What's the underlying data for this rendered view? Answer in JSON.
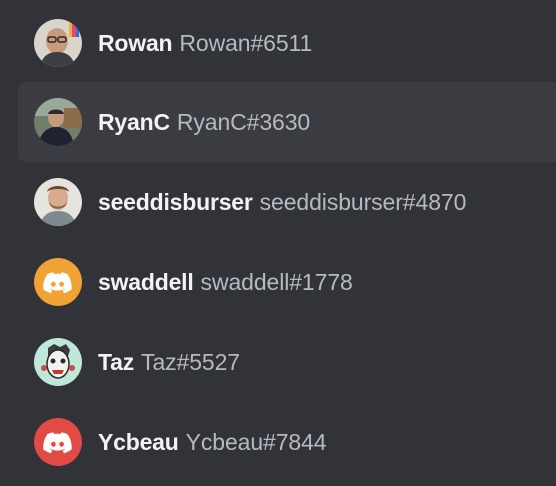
{
  "colors": {
    "background": "#313338",
    "hover_row": "#3a3c42",
    "name_text": "#f2f3f5",
    "tag_text": "#b5bac1",
    "swaddell_avatar_bg": "#f0a232",
    "ycbeau_avatar_bg": "#e24a46"
  },
  "members": [
    {
      "name": "Rowan",
      "tag": "Rowan#6511",
      "avatar": "photo-man-glasses-icon"
    },
    {
      "name": "RyanC",
      "tag": "RyanC#3630",
      "avatar": "photo-man-outdoors-icon"
    },
    {
      "name": "seeddisburser",
      "tag": "seeddisburser#4870",
      "avatar": "photo-man-beard-icon"
    },
    {
      "name": "swaddell",
      "tag": "swaddell#1778",
      "avatar": "discord-logo-icon"
    },
    {
      "name": "Taz",
      "tag": "Taz#5527",
      "avatar": "illustrated-face-icon"
    },
    {
      "name": "Ycbeau",
      "tag": "Ycbeau#7844",
      "avatar": "discord-logo-icon"
    }
  ]
}
